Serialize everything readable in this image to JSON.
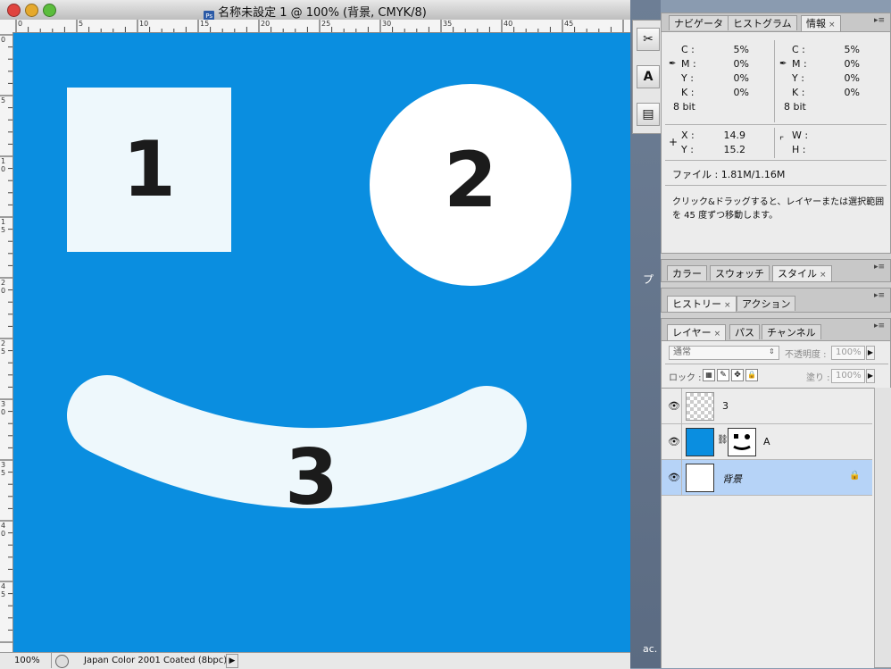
{
  "document": {
    "title": "名称未設定 1 @ 100% (背景, CMYK/8)",
    "ps_icon": "Ps",
    "ruler_top_labels": [
      "0",
      "5",
      "10",
      "15",
      "20",
      "25",
      "30",
      "35",
      "40",
      "45"
    ],
    "ruler_left_labels": [
      "0",
      "5",
      "1\n0",
      "1\n5",
      "2\n0",
      "2\n5",
      "3\n0",
      "3\n5",
      "4\n0",
      "4\n5"
    ],
    "shape1_label": "1",
    "shape2_label": "2",
    "shape3_label": "3",
    "canvas_color": "#0a8ee0",
    "status": {
      "zoom": "100%",
      "profile": "Japan Color 2001 Coated (8bpc)",
      "arrow": "▶"
    }
  },
  "desktop_text": {
    "right_fragment_1": "プ",
    "right_fragment_2": "ac."
  },
  "toolbox": {
    "icons": [
      "scissors-icon",
      "type-icon",
      "notes-icon"
    ],
    "type_label": "A"
  },
  "info_panel": {
    "tabs": [
      "ナビゲータ",
      "ヒストグラム",
      "情報"
    ],
    "close": "×",
    "menu": "▸≡",
    "left": {
      "c": "5%",
      "m": "0%",
      "y": "0%",
      "k": "0%",
      "bits": "8 bit"
    },
    "right": {
      "c": "5%",
      "m": "0%",
      "y": "0%",
      "k": "0%",
      "bits": "8 bit"
    },
    "labels": {
      "c": "C :",
      "m": "M :",
      "y": "Y :",
      "k": "K :",
      "x": "X :",
      "y2": "Y :",
      "w": "W :",
      "h": "H :"
    },
    "x_val": "14.9",
    "y_val": "15.2",
    "file_info": "ファイル : 1.81M/1.16M",
    "hint_line1": "クリック&ドラッグすると、レイヤーまたは選択範囲",
    "hint_line2": "を 45 度ずつ移動します。"
  },
  "color_panel": {
    "tabs": [
      "カラー",
      "スウォッチ",
      "スタイル"
    ],
    "close": "×"
  },
  "history_panel": {
    "tabs": [
      "ヒストリー",
      "アクション"
    ],
    "close": "×"
  },
  "layers_panel": {
    "tabs": [
      "レイヤー",
      "パス",
      "チャンネル"
    ],
    "close": "×",
    "blend_mode": "通常",
    "opacity_label": "不透明度 :",
    "opacity_value": "100%",
    "lock_label": "ロック :",
    "fill_label": "塗り :",
    "fill_value": "100%",
    "layers": [
      {
        "name": "3"
      },
      {
        "name": "A"
      },
      {
        "name": "背景"
      }
    ],
    "selected_color": "#b6d3f7"
  }
}
